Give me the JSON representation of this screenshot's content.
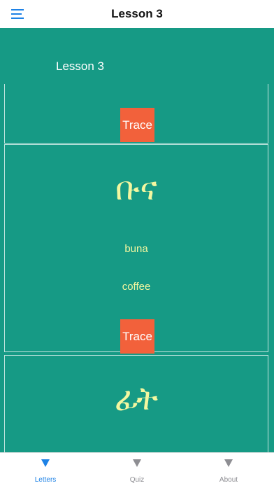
{
  "header": {
    "title": "Lesson 3",
    "menu_icon": "hamburger-menu-icon",
    "accent_color": "#1E82E6"
  },
  "lesson": {
    "heading": "Lesson 3",
    "background_color": "#169A85",
    "text_color": "#F3F7A0",
    "trace_color": "#F2613B",
    "cards": [
      {
        "trace_label": "Trace"
      },
      {
        "glyph": "ቡና",
        "transliteration": "buna",
        "translation": "coffee",
        "trace_label": "Trace"
      },
      {
        "glyph": "ፊት"
      }
    ]
  },
  "tabbar": {
    "tabs": [
      {
        "label": "Letters",
        "icon": "triangle-down-icon",
        "active": true
      },
      {
        "label": "Quiz",
        "icon": "triangle-down-icon",
        "active": false
      },
      {
        "label": "About",
        "icon": "triangle-down-icon",
        "active": false
      }
    ]
  }
}
